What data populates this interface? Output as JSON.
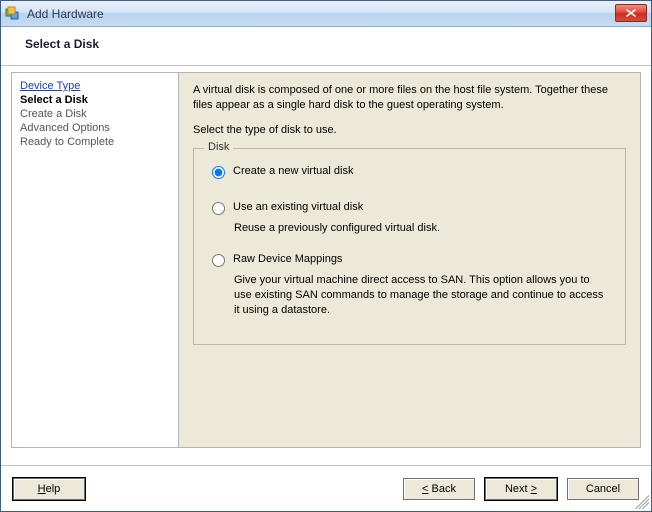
{
  "titlebar": {
    "title": "Add Hardware",
    "close_label": "×"
  },
  "header": {
    "heading": "Select a Disk"
  },
  "sidebar": {
    "items": [
      {
        "label": "Device Type",
        "kind": "link"
      },
      {
        "label": "Select a Disk",
        "kind": "current"
      },
      {
        "label": "Create a Disk",
        "kind": "normal"
      },
      {
        "label": "Advanced Options",
        "kind": "normal"
      },
      {
        "label": "Ready to Complete",
        "kind": "normal"
      }
    ]
  },
  "main": {
    "intro": "A virtual disk is composed of one or more files on the host file system. Together these files appear as a single hard disk to the guest operating system.",
    "prompt": "Select the type of disk to use.",
    "group_title": "Disk",
    "options": [
      {
        "label": "Create a new virtual disk",
        "description": "",
        "checked": true
      },
      {
        "label": "Use an existing virtual disk",
        "description": "Reuse a previously configured virtual disk.",
        "checked": false
      },
      {
        "label": "Raw Device Mappings",
        "description": "Give your virtual machine direct access to SAN. This option allows you to use existing SAN commands to manage the storage and continue to access it using a datastore.",
        "checked": false
      }
    ]
  },
  "footer": {
    "help": "Help",
    "back": "Back",
    "next": "Next",
    "cancel": "Cancel"
  }
}
